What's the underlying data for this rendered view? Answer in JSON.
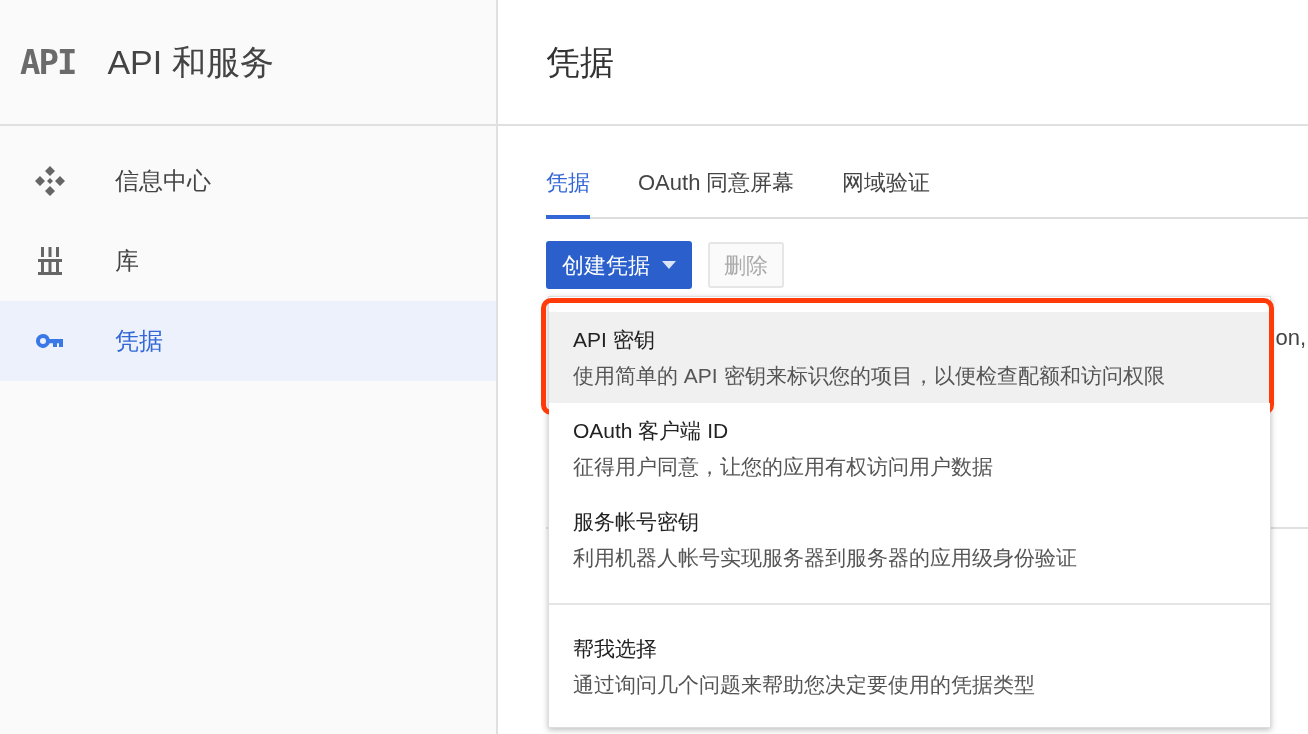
{
  "sidebar": {
    "logo": "API",
    "title": "API 和服务",
    "items": [
      {
        "kind": "dashboard",
        "label": "信息中心",
        "selected": false
      },
      {
        "kind": "library",
        "label": "库",
        "selected": false
      },
      {
        "kind": "key",
        "label": "凭据",
        "selected": true
      }
    ]
  },
  "main": {
    "title": "凭据",
    "tabs": [
      {
        "label": "凭据",
        "selected": true
      },
      {
        "label": "OAuth 同意屏幕",
        "selected": false
      },
      {
        "label": "网域验证",
        "selected": false
      }
    ],
    "create_button": "创建凭据",
    "delete_button": {
      "label": "删除",
      "disabled": true
    },
    "background_text": "on,",
    "menu": {
      "groups": [
        [
          {
            "title": "API 密钥",
            "description": "使用简单的 API 密钥来标识您的项目，以便检查配额和访问权限",
            "selected": true,
            "outlined": true
          },
          {
            "title": "OAuth 客户端 ID",
            "description": "征得用户同意，让您的应用有权访问用户数据",
            "selected": false,
            "outlined": false
          },
          {
            "title": "服务帐号密钥",
            "description": "利用机器人帐号实现服务器到服务器的应用级身份验证",
            "selected": false,
            "outlined": false
          }
        ],
        [
          {
            "title": "帮我选择",
            "description": "通过询问几个问题来帮助您决定要使用的凭据类型",
            "selected": false,
            "outlined": false
          }
        ]
      ]
    }
  }
}
